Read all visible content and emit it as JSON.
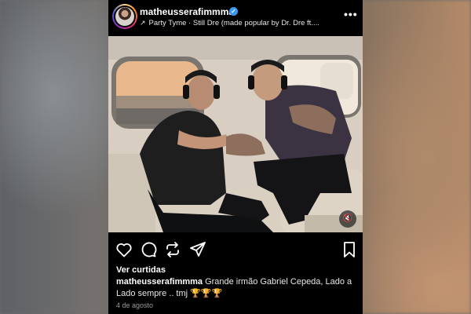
{
  "post": {
    "username": "matheusserafimmma",
    "verified_icon": "check-icon",
    "music_label": "Party Tyme · Still Dre (made popular by Dr. Dre ft....",
    "more_icon": "more-options-icon",
    "more_label": "•••",
    "mute_icon": "speaker-muted-icon",
    "mute_label": "🔇",
    "actions": {
      "like_icon": "heart-icon",
      "comment_icon": "comment-icon",
      "repost_icon": "repost-icon",
      "share_icon": "share-icon",
      "save_icon": "bookmark-icon"
    },
    "likes_label": "Ver curtidas",
    "caption_user": "matheusserafimmma",
    "caption_text": "Grande irmão Gabriel Cepeda,  Lado a Lado sempre .. tmj 🏆🏆🏆",
    "date": "4 de agosto"
  },
  "colors": {
    "background": "#000000",
    "verified": "#3b97f0",
    "text": "#f5f5f5",
    "muted_text": "#9a9a9a"
  }
}
